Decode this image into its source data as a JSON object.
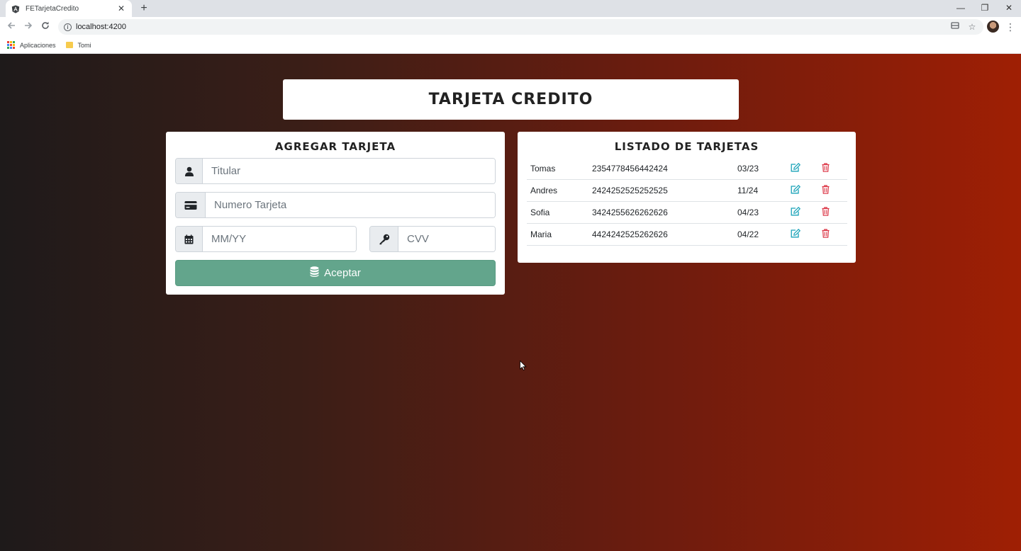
{
  "browser": {
    "tab_title": "FETarjetaCredito",
    "tab_close": "✕",
    "new_tab": "+",
    "window_controls": [
      "—",
      "❐",
      "✕"
    ],
    "url": "localhost:4200",
    "bookmarks": [
      {
        "label": "Aplicaciones",
        "icon": "apps-grid-icon"
      },
      {
        "label": "Tomi",
        "icon": "folder-icon"
      }
    ]
  },
  "header": {
    "title": "Tarjeta Credito"
  },
  "form": {
    "heading": "Agregar Tarjeta",
    "titular_placeholder": "Titular",
    "numero_placeholder": "Numero Tarjeta",
    "fecha_placeholder": "MM/YY",
    "cvv_placeholder": "CVV",
    "submit_label": "Aceptar",
    "submit_color": "#63a58c"
  },
  "list": {
    "heading": "Listado de Tarjetas",
    "edit_color": "#17a2b8",
    "delete_color": "#dc3545",
    "rows": [
      {
        "titular": "Tomas",
        "numero": "2354778456442424",
        "expiracion": "03/23"
      },
      {
        "titular": "Andres",
        "numero": "2424252525252525",
        "expiracion": "11/24"
      },
      {
        "titular": "Sofia",
        "numero": "3424255626262626",
        "expiracion": "04/23"
      },
      {
        "titular": "Maria",
        "numero": "4424242525262626",
        "expiracion": "04/22"
      }
    ]
  }
}
